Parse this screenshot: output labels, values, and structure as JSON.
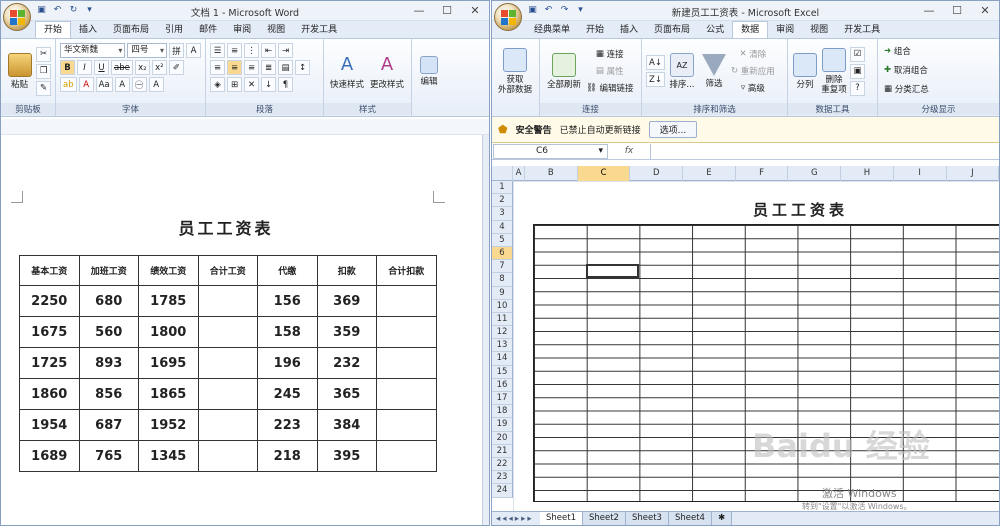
{
  "word": {
    "title": "文档 1 - Microsoft Word",
    "tabs": [
      "开始",
      "插入",
      "页面布局",
      "引用",
      "邮件",
      "审阅",
      "视图",
      "开发工具"
    ],
    "active_tab": "开始",
    "ribbon": {
      "clipboard": {
        "label": "剪贴板",
        "paste": "粘贴"
      },
      "font": {
        "label": "字体",
        "font_name": "华文新魏",
        "font_size": "四号"
      },
      "paragraph": {
        "label": "段落"
      },
      "styles": {
        "label": "样式",
        "quick": "快速样式",
        "change": "更改样式"
      },
      "editing": {
        "label": "编辑"
      }
    },
    "document": {
      "title": "员工工资表",
      "headers": [
        "基本工资",
        "加班工资",
        "绩效工资",
        "合计工资",
        "代缴",
        "扣款",
        "合计扣款"
      ],
      "rows": [
        [
          "2250",
          "680",
          "1785",
          "",
          "156",
          "369",
          ""
        ],
        [
          "1675",
          "560",
          "1800",
          "",
          "158",
          "359",
          ""
        ],
        [
          "1725",
          "893",
          "1695",
          "",
          "196",
          "232",
          ""
        ],
        [
          "1860",
          "856",
          "1865",
          "",
          "245",
          "365",
          ""
        ],
        [
          "1954",
          "687",
          "1952",
          "",
          "223",
          "384",
          ""
        ],
        [
          "1689",
          "765",
          "1345",
          "",
          "218",
          "395",
          ""
        ]
      ]
    }
  },
  "excel": {
    "title": "新建员工工资表 - Microsoft Excel",
    "tabs": [
      "经典菜单",
      "开始",
      "插入",
      "页面布局",
      "公式",
      "数据",
      "审阅",
      "视图",
      "开发工具"
    ],
    "active_tab": "数据",
    "ribbon": {
      "get_external": {
        "label": "获取\n外部数据"
      },
      "connections": {
        "label": "连接",
        "refresh_all": "全部刷新",
        "connect": "连接",
        "props": "属性",
        "edit_links": "编辑链接"
      },
      "sort_filter": {
        "label": "排序和筛选",
        "sort": "排序...",
        "filter": "筛选",
        "clear": "清除",
        "reapply": "重新应用",
        "advanced": "高级"
      },
      "data_tools": {
        "label": "数据工具",
        "split": "分列",
        "remove_dup": "删除\n重复项"
      },
      "outline": {
        "label": "分级显示",
        "group": "组合",
        "ungroup": "取消组合",
        "subtotal": "分类汇总"
      }
    },
    "security": {
      "title": "安全警告",
      "message": "已禁止自动更新链接",
      "options": "选项..."
    },
    "name_box": "C6",
    "fx": "fx",
    "columns": [
      "A",
      "B",
      "C",
      "D",
      "E",
      "F",
      "G",
      "H",
      "I",
      "J"
    ],
    "selected_col": "C",
    "rows": [
      "1",
      "2",
      "3",
      "4",
      "5",
      "6",
      "7",
      "8",
      "9",
      "10",
      "11",
      "12",
      "13",
      "14",
      "15",
      "16",
      "17",
      "18",
      "19",
      "20",
      "21",
      "22",
      "23",
      "24"
    ],
    "selected_row": "6",
    "sheet_title": "员工工资表",
    "sheets": [
      "Sheet1",
      "Sheet2",
      "Sheet3",
      "Sheet4"
    ],
    "active_sheet": "Sheet1"
  },
  "watermark": {
    "baidu": "Baidu 经验",
    "activate": "激活 Windows",
    "activate_hint": "转到\"设置\"以激活 Windows。"
  }
}
